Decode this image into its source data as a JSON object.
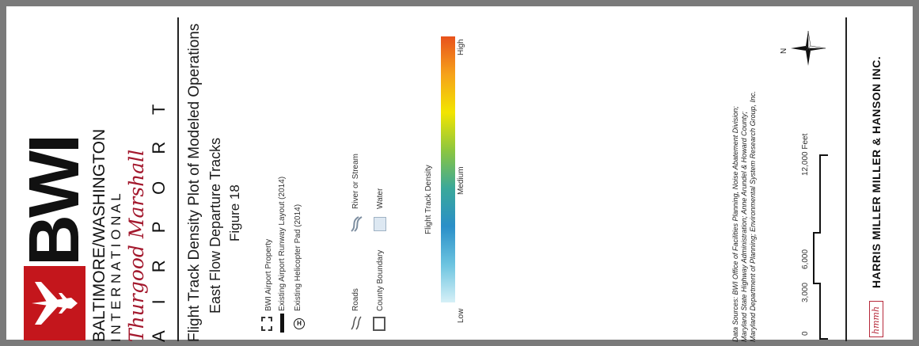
{
  "logo": {
    "letters": "BWI",
    "line1": "BALTIMORE/WASHINGTON",
    "line2": "I N T E R N A T I O N A L",
    "script": "Thurgood Marshall",
    "line4": "A I R P O R T"
  },
  "title": {
    "main": "Flight Track Density Plot of Modeled Operations",
    "sub": "East Flow Departure Tracks",
    "figure": "Figure 18"
  },
  "legend": {
    "items": [
      {
        "label": "BWI Airport Property",
        "icon": "airport-property-icon"
      },
      {
        "label": "Existing Airport Runway Layout (2014)",
        "icon": "runway-icon"
      },
      {
        "label": "Existing Helicopter Pad (2014)",
        "icon": "helipad-icon",
        "glyph": "H"
      },
      {
        "label": "Roads",
        "icon": "road-icon"
      },
      {
        "label": "County Boundary",
        "icon": "county-boundary-icon"
      },
      {
        "label": "River or Stream",
        "icon": "river-icon"
      },
      {
        "label": "Water",
        "icon": "water-icon"
      }
    ],
    "colors": {
      "water": "#dde8f2",
      "river": "#7d8ea0"
    }
  },
  "density": {
    "title": "Flight Track Density",
    "low": "Low",
    "medium": "Medium",
    "high": "High",
    "gradient": [
      "#d6f0f7",
      "#6cc4e0",
      "#2a8fc8",
      "#3aa89a",
      "#8cc63f",
      "#f2e500",
      "#f6a21a",
      "#e8521c"
    ]
  },
  "sources": {
    "line1": "Data Sources:  BWI Office of Facilities Planning, Noise Abatement Division;",
    "line2": "Maryland State Highway Administration; Anne Arundel & Howard County;",
    "line3": "Maryland Department of Planning; Environmental System Research Group, Inc."
  },
  "scale": {
    "labels": [
      "0",
      "3,000",
      "6,000",
      "12,000  Feet"
    ]
  },
  "north": "N",
  "company": {
    "name": "HARRIS MILLER MILLER & HANSON INC.",
    "logo_text": "hmmh"
  }
}
